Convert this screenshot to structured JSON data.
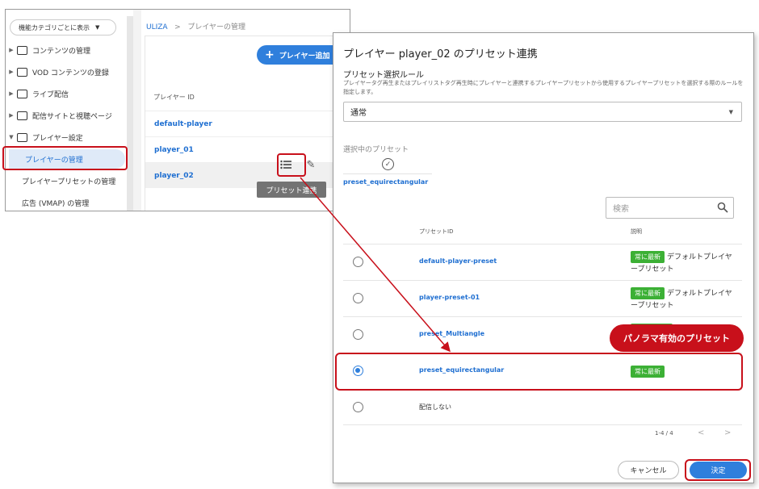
{
  "bg": {
    "filter_label": "機能カテゴリごとに表示",
    "nav": [
      {
        "label": "コンテンツの管理"
      },
      {
        "label": "VOD コンテンツの登録"
      },
      {
        "label": "ライブ配信"
      },
      {
        "label": "配信サイトと視聴ページ"
      },
      {
        "label": "プレイヤー設定"
      }
    ],
    "sub": [
      {
        "label": "プレイヤーの管理"
      },
      {
        "label": "プレイヤープリセットの管理"
      },
      {
        "label": "広告 (VMAP) の管理"
      }
    ],
    "breadcrumb_root": "ULIZA",
    "breadcrumb_sep": ">",
    "breadcrumb_current": "プレイヤーの管理",
    "add_player_label": "プレイヤー追加",
    "col_player_id": "プレイヤー ID",
    "players": [
      {
        "id": "default-player"
      },
      {
        "id": "player_01"
      },
      {
        "id": "player_02"
      }
    ],
    "tooltip": "プリセット連携"
  },
  "dialog": {
    "title": "プレイヤー player_02 のプリセット連携",
    "rule_label": "プリセット選択ルール",
    "rule_desc": "プレイヤータグ再生またはプレイリストタグ再生時にプレイヤーと連携するプレイヤープリセットから使用するプレイヤープリセットを選択する際のルールを指定します。",
    "rule_value": "通常",
    "selected_label": "選択中のプリセット",
    "selected_name": "preset_equirectangular",
    "search_placeholder": "検索",
    "col_preset_id": "プリセットID",
    "col_desc": "説明",
    "rows": [
      {
        "name": "default-player-preset",
        "badge": "常に最新",
        "desc": "デフォルトプレイヤープリセット",
        "selected": false
      },
      {
        "name": "player-preset-01",
        "badge": "常に最新",
        "desc": "デフォルトプレイヤープリセット",
        "selected": false
      },
      {
        "name": "preset_Multiangle",
        "badge": "",
        "desc": "",
        "selected": false
      },
      {
        "name": "preset_equirectangular",
        "badge": "常に最新",
        "desc": "",
        "selected": true
      },
      {
        "name": "配信しない",
        "badge": "",
        "desc": "",
        "selected": false
      }
    ],
    "pagination": "1-4 / 4",
    "cancel_label": "キャンセル",
    "ok_label": "決定"
  },
  "callout": "パノラマ有効のプリセット",
  "colors": {
    "accent": "#2f7fdc",
    "highlight": "#c8101b",
    "badge": "#3cb035"
  }
}
